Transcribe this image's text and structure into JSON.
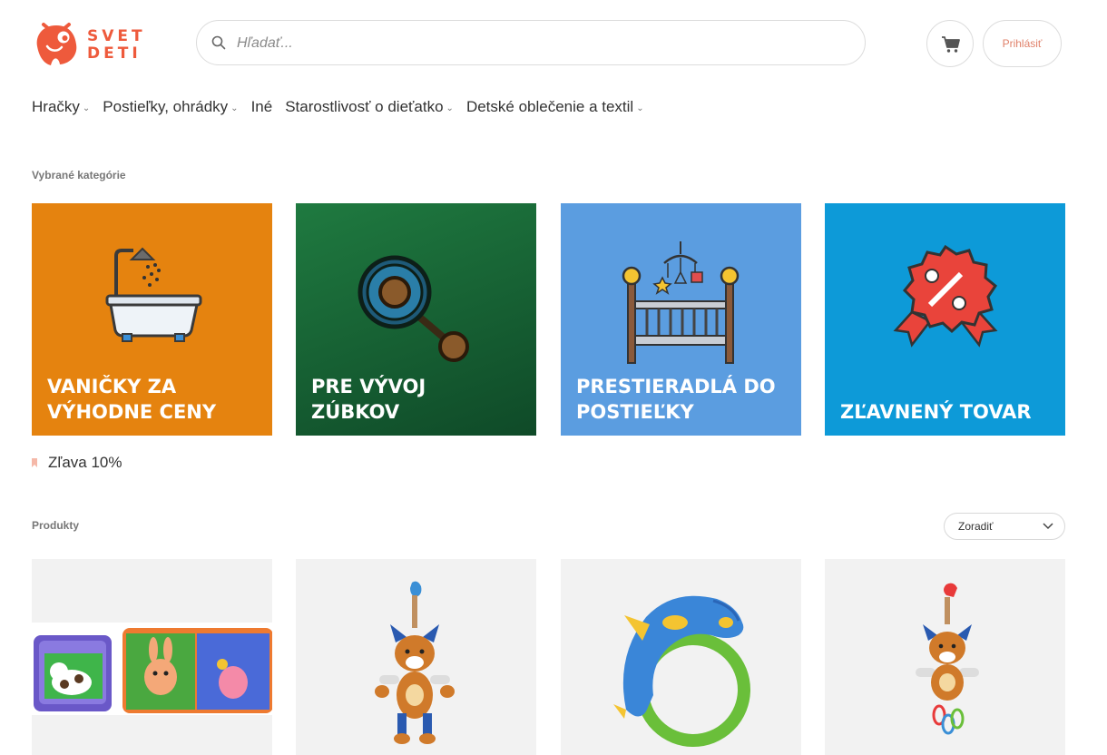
{
  "brand": {
    "name_line1": "SVET",
    "name_line2": "DETI",
    "color": "#ee5a3c"
  },
  "search": {
    "placeholder": "Hľadať..."
  },
  "header": {
    "cart_icon": "cart-icon",
    "login_label": "Prihlásiť"
  },
  "nav": {
    "items": [
      {
        "label": "Hračky",
        "has_dropdown": true
      },
      {
        "label": "Postieľky, ohrádky",
        "has_dropdown": true
      },
      {
        "label": "Iné",
        "has_dropdown": false
      },
      {
        "label": "Starostlivosť o dieťatko",
        "has_dropdown": true
      },
      {
        "label": "Detské oblečenie a textil",
        "has_dropdown": true
      }
    ]
  },
  "categories": {
    "heading": "Vybrané kategórie",
    "tiles": [
      {
        "label": "VANIČKY ZA VÝHODNE CENY",
        "icon": "bathtub-icon",
        "color": "#e5830f"
      },
      {
        "label": "PRE VÝVOJ ZÚBKOV",
        "icon": "teether-rattle-icon",
        "color": "#1e6b3a"
      },
      {
        "label": "PRESTIERADLÁ DO POSTIEĽKY",
        "icon": "crib-icon",
        "color": "#5b9de0"
      },
      {
        "label": "ZĽAVNENÝ TOVAR",
        "icon": "discount-badge-icon",
        "color": "#0d9ad8"
      }
    ]
  },
  "discount_tag": {
    "label": "Zľava 10%"
  },
  "products": {
    "heading": "Produkty",
    "sort_label": "Zoradiť",
    "items": [
      {
        "image": "bath-books-image"
      },
      {
        "image": "fox-clip-toy-image"
      },
      {
        "image": "dolphin-teether-image"
      },
      {
        "image": "fox-rattle-toy-image"
      }
    ]
  }
}
